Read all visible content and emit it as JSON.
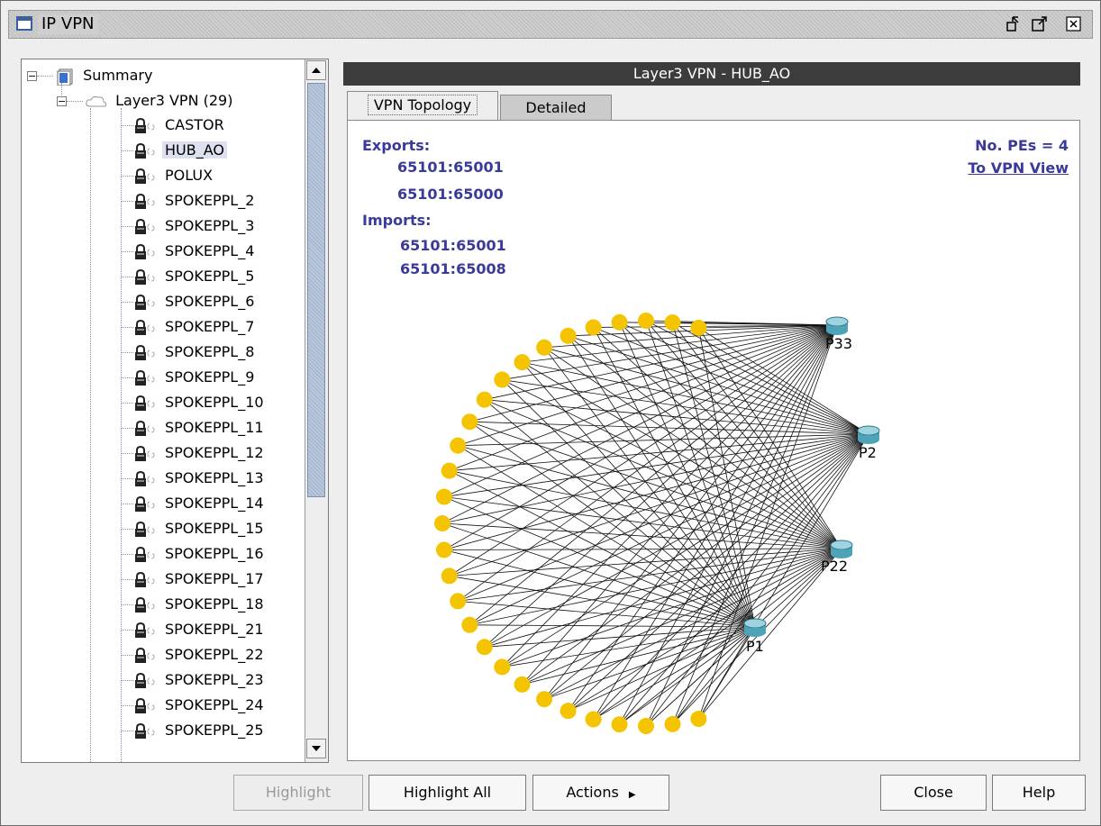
{
  "window": {
    "title": "IP VPN",
    "icons": [
      "window-icon",
      "restore-icon",
      "maximize-icon",
      "close-icon"
    ]
  },
  "tree": {
    "root": {
      "label": "Summary",
      "icon": "summary-icon"
    },
    "group": {
      "label": "Layer3 VPN (29)",
      "icon": "cloud-icon"
    },
    "selected": "HUB_AO",
    "items": [
      "CASTOR",
      "HUB_AO",
      "POLUX",
      "SPOKEPPL_2",
      "SPOKEPPL_3",
      "SPOKEPPL_4",
      "SPOKEPPL_5",
      "SPOKEPPL_6",
      "SPOKEPPL_7",
      "SPOKEPPL_8",
      "SPOKEPPL_9",
      "SPOKEPPL_10",
      "SPOKEPPL_11",
      "SPOKEPPL_12",
      "SPOKEPPL_13",
      "SPOKEPPL_14",
      "SPOKEPPL_15",
      "SPOKEPPL_16",
      "SPOKEPPL_17",
      "SPOKEPPL_18",
      "SPOKEPPL_21",
      "SPOKEPPL_22",
      "SPOKEPPL_23",
      "SPOKEPPL_24",
      "SPOKEPPL_25"
    ]
  },
  "panel": {
    "header": "Layer3 VPN - HUB_AO",
    "tabs": [
      {
        "label": "VPN Topology",
        "active": true
      },
      {
        "label": "Detailed",
        "active": false
      }
    ]
  },
  "topology": {
    "exports_label": "Exports:",
    "exports": [
      "65101:65001",
      "65101:65000"
    ],
    "imports_label": "Imports:",
    "imports": [
      "65101:65001",
      "65101:65008"
    ],
    "pe_count": "No. PEs = 4",
    "vpn_view_link": "To VPN View",
    "pes": [
      "P33",
      "P2",
      "P22",
      "P1"
    ],
    "site_count": 29,
    "site_color": "#f5c400",
    "router_color": "#4fa3b8"
  },
  "buttons": {
    "highlight": "Highlight",
    "highlight_all": "Highlight All",
    "actions": "Actions",
    "close": "Close",
    "help": "Help"
  }
}
